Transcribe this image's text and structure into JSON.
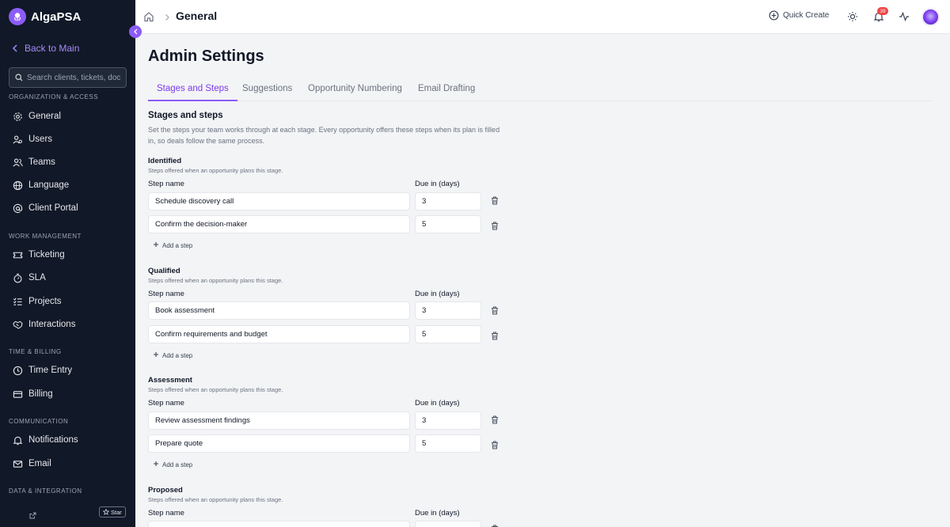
{
  "brand": {
    "name": "AlgaPSA"
  },
  "sidebar": {
    "back_label": "Back to Main",
    "search_placeholder": "Search clients, tickets, doc",
    "sections": [
      {
        "label": "ORGANIZATION & ACCESS",
        "items": [
          {
            "label": "General",
            "icon": "gear-icon"
          },
          {
            "label": "Users",
            "icon": "users-icon"
          },
          {
            "label": "Teams",
            "icon": "teams-icon"
          },
          {
            "label": "Language",
            "icon": "globe-icon"
          },
          {
            "label": "Client Portal",
            "icon": "at-icon"
          }
        ]
      },
      {
        "label": "WORK MANAGEMENT",
        "items": [
          {
            "label": "Ticketing",
            "icon": "ticket-icon"
          },
          {
            "label": "SLA",
            "icon": "timer-icon"
          },
          {
            "label": "Projects",
            "icon": "list-check-icon"
          },
          {
            "label": "Interactions",
            "icon": "handshake-icon"
          }
        ]
      },
      {
        "label": "TIME & BILLING",
        "items": [
          {
            "label": "Time Entry",
            "icon": "clock-icon"
          },
          {
            "label": "Billing",
            "icon": "credit-card-icon"
          }
        ]
      },
      {
        "label": "COMMUNICATION",
        "items": [
          {
            "label": "Notifications",
            "icon": "bell-icon"
          },
          {
            "label": "Email",
            "icon": "mail-icon"
          }
        ]
      },
      {
        "label": "DATA & INTEGRATION",
        "items": []
      }
    ],
    "star_label": "Star"
  },
  "header": {
    "breadcrumb_title": "General",
    "quick_create_label": "Quick Create",
    "notification_count": "39"
  },
  "main": {
    "title": "Admin Settings",
    "tabs": [
      {
        "label": "Stages and Steps",
        "active": true
      },
      {
        "label": "Suggestions",
        "active": false
      },
      {
        "label": "Opportunity Numbering",
        "active": false
      },
      {
        "label": "Email Drafting",
        "active": false
      }
    ],
    "section_title": "Stages and steps",
    "section_description": "Set the steps your team works through at each stage. Every opportunity offers these steps when its plan is filled in, so deals follow the same process.",
    "step_name_label": "Step name",
    "due_label": "Due in (days)",
    "add_step_label": "Add a step",
    "stages": [
      {
        "name": "Identified",
        "description": "Steps offered when an opportunity plans this stage.",
        "steps": [
          {
            "name": "Schedule discovery call",
            "due": "3"
          },
          {
            "name": "Confirm the decision-maker",
            "due": "5"
          }
        ]
      },
      {
        "name": "Qualified",
        "description": "Steps offered when an opportunity plans this stage.",
        "steps": [
          {
            "name": "Book assessment",
            "due": "3"
          },
          {
            "name": "Confirm requirements and budget",
            "due": "5"
          }
        ]
      },
      {
        "name": "Assessment",
        "description": "Steps offered when an opportunity plans this stage.",
        "steps": [
          {
            "name": "Review assessment findings",
            "due": "3"
          },
          {
            "name": "Prepare quote",
            "due": "5"
          }
        ]
      },
      {
        "name": "Proposed",
        "description": "Steps offered when an opportunity plans this stage.",
        "steps": [
          {
            "name": "",
            "due": ""
          }
        ]
      }
    ]
  },
  "colors": {
    "accent": "#8b5cf6",
    "sidebar_bg": "#111827",
    "badge": "#ef4444"
  }
}
